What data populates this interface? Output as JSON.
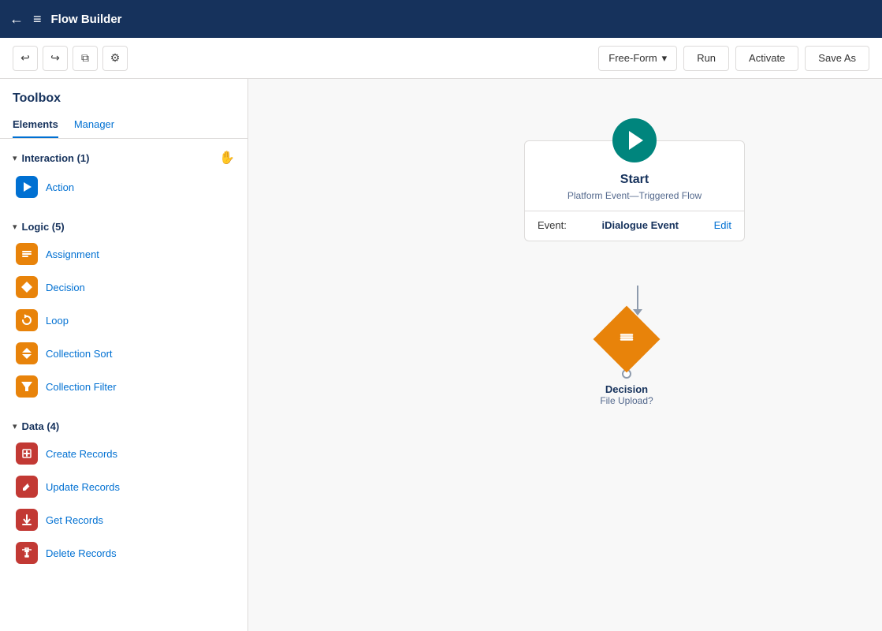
{
  "nav": {
    "back_icon": "←",
    "logo_icon": "≡",
    "title": "Flow Builder"
  },
  "toolbar": {
    "undo_label": "↩",
    "redo_label": "↪",
    "copy_label": "⧉",
    "settings_label": "⚙",
    "dropdown_label": "Free-Form",
    "dropdown_chevron": "▾",
    "run_label": "Run",
    "activate_label": "Activate",
    "save_label": "Save As"
  },
  "toolbox": {
    "title": "Toolbox",
    "tabs": [
      {
        "id": "elements",
        "label": "Elements",
        "active": true
      },
      {
        "id": "manager",
        "label": "Manager",
        "active": false
      }
    ],
    "categories": [
      {
        "id": "interaction",
        "label": "Interaction (1)",
        "expanded": true,
        "items": [
          {
            "id": "action",
            "label": "Action",
            "icon": "⚡",
            "icon_color": "icon-blue"
          }
        ]
      },
      {
        "id": "logic",
        "label": "Logic (5)",
        "expanded": true,
        "items": [
          {
            "id": "assignment",
            "label": "Assignment",
            "icon": "≡",
            "icon_color": "icon-orange"
          },
          {
            "id": "decision",
            "label": "Decision",
            "icon": "⇄",
            "icon_color": "icon-orange"
          },
          {
            "id": "loop",
            "label": "Loop",
            "icon": "↻",
            "icon_color": "icon-orange"
          },
          {
            "id": "collection-sort",
            "label": "Collection Sort",
            "icon": "↕",
            "icon_color": "icon-orange"
          },
          {
            "id": "collection-filter",
            "label": "Collection Filter",
            "icon": "▼",
            "icon_color": "icon-orange"
          }
        ]
      },
      {
        "id": "data",
        "label": "Data (4)",
        "expanded": true,
        "items": [
          {
            "id": "create-records",
            "label": "Create Records",
            "icon": "✚",
            "icon_color": "icon-red"
          },
          {
            "id": "update-records",
            "label": "Update Records",
            "icon": "✎",
            "icon_color": "icon-red"
          },
          {
            "id": "get-records",
            "label": "Get Records",
            "icon": "↓",
            "icon_color": "icon-red"
          },
          {
            "id": "delete-records",
            "label": "Delete Records",
            "icon": "✕",
            "icon_color": "icon-red"
          }
        ]
      }
    ]
  },
  "canvas": {
    "start_node": {
      "title": "Start",
      "subtitle": "Platform Event—Triggered Flow",
      "event_label": "Event:",
      "event_value": "iDialogue Event",
      "edit_label": "Edit"
    },
    "decision_node": {
      "label": "Decision",
      "sublabel": "File Upload?"
    }
  }
}
